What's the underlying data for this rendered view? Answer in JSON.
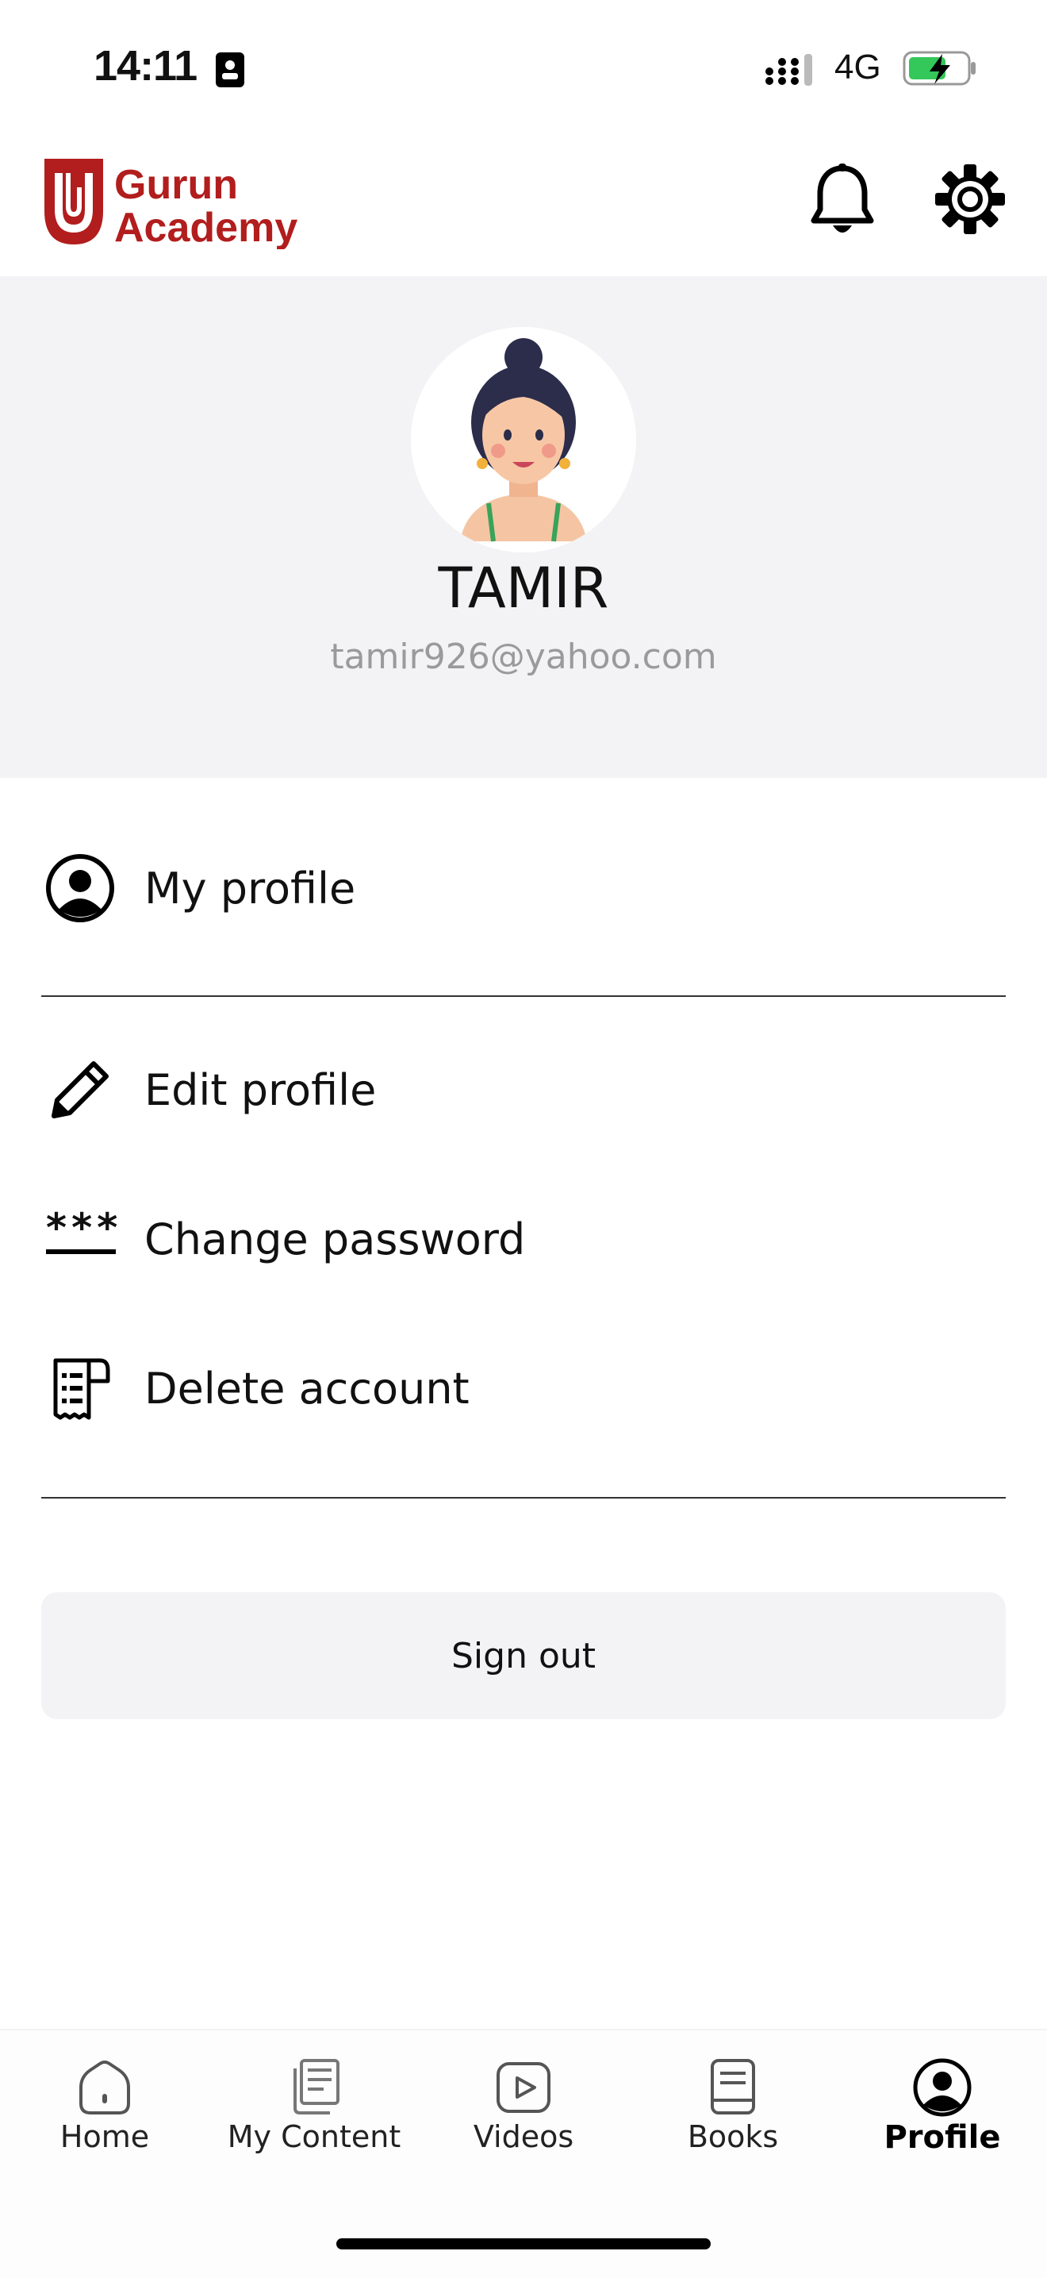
{
  "status_bar": {
    "time": "14:11",
    "network": "4G",
    "battery_color": "#34c759"
  },
  "header": {
    "logo_line1": "Gurun",
    "logo_line2": "Academy",
    "brand_color": "#b21d1d",
    "icons": [
      "bell-icon",
      "gear-icon"
    ]
  },
  "profile": {
    "name": "TAMIR",
    "email": "tamir926@yahoo.com"
  },
  "menu": {
    "my_profile": "My profile",
    "edit_profile": "Edit profile",
    "change_password": "Change password",
    "delete_account": "Delete account",
    "password_mask": "***"
  },
  "sign_out": "Sign out",
  "tabs": [
    {
      "label": "Home",
      "icon": "home-icon",
      "active": false
    },
    {
      "label": "My Content",
      "icon": "content-icon",
      "active": false
    },
    {
      "label": "Videos",
      "icon": "video-icon",
      "active": false
    },
    {
      "label": "Books",
      "icon": "book-icon",
      "active": false
    },
    {
      "label": "Profile",
      "icon": "profile-icon",
      "active": true
    }
  ]
}
